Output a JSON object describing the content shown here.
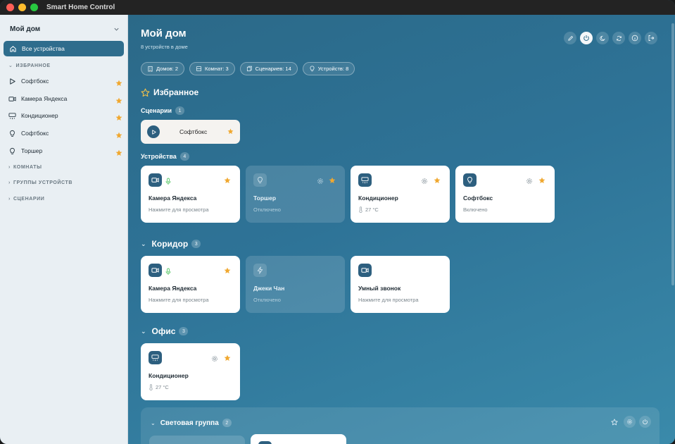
{
  "window": {
    "title": "Smart Home Control"
  },
  "sidebar": {
    "home_select": "Мой дом",
    "all_devices": "Все устройства",
    "favorites_header": "ИЗБРАННОЕ",
    "favorites": [
      {
        "label": "Софтбокс",
        "icon": "play-icon"
      },
      {
        "label": "Камера Яндекса",
        "icon": "camera-icon"
      },
      {
        "label": "Кондиционер",
        "icon": "ac-icon"
      },
      {
        "label": "Софтбокс",
        "icon": "bulb-icon"
      },
      {
        "label": "Торшер",
        "icon": "bulb-icon"
      }
    ],
    "rooms_header": "КОМНАТЫ",
    "groups_header": "ГРУППЫ УСТРОЙСТВ",
    "scenes_header": "СЦЕНАРИИ"
  },
  "header": {
    "title": "Мой дом",
    "subtitle": "8 устройств в доме"
  },
  "chips": [
    {
      "label": "Домов: 2",
      "icon": "building-icon"
    },
    {
      "label": "Комнат: 3",
      "icon": "room-icon"
    },
    {
      "label": "Сценариев: 14",
      "icon": "scenario-icon"
    },
    {
      "label": "Устройств: 8",
      "icon": "bulb-icon"
    }
  ],
  "favorites": {
    "title": "Избранное",
    "scenes_label": "Сценарии",
    "scenes_count": "1",
    "scene": {
      "name": "Софтбокс"
    },
    "devices_label": "Устройства",
    "devices_count": "4",
    "devices": [
      {
        "name": "Камера Яндекса",
        "status": "Нажмите для просмотра"
      },
      {
        "name": "Торшер",
        "status": "Отключено"
      },
      {
        "name": "Кондиционер",
        "status": "27 °C"
      },
      {
        "name": "Софтбокс",
        "status": "Включено"
      }
    ]
  },
  "corridor": {
    "title": "Коридор",
    "count": "3",
    "devices": [
      {
        "name": "Камера Яндекса",
        "status": "Нажмите для просмотра"
      },
      {
        "name": "Джеки Чан",
        "status": "Отключено"
      },
      {
        "name": "Умный звонок",
        "status": "Нажмите для просмотра"
      }
    ]
  },
  "office": {
    "title": "Офис",
    "count": "3",
    "devices": [
      {
        "name": "Кондиционер",
        "status": "27 °C"
      }
    ]
  },
  "light_group": {
    "title": "Световая группа",
    "count": "2"
  },
  "colors": {
    "accent": "#2f6d8d",
    "star": "#f0a830",
    "mic": "#5bc86a"
  }
}
